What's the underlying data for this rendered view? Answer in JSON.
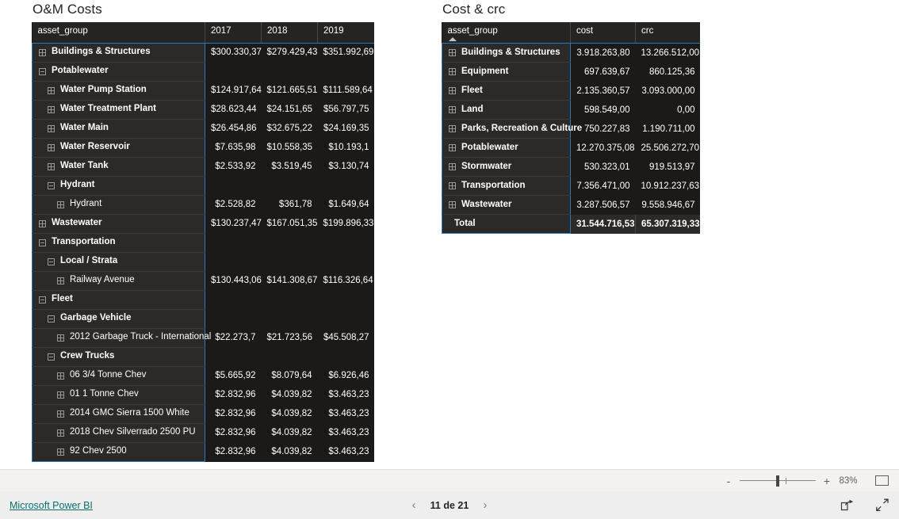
{
  "visuals": {
    "left": {
      "title": "O&M Costs",
      "columns": [
        "asset_group",
        "2017",
        "2018",
        "2019"
      ],
      "rows": [
        {
          "label": "Buildings & Structures",
          "level": 0,
          "bold": true,
          "icon": "plus",
          "values": [
            "$300.330,37",
            "$279.429,43",
            "$351.992,69"
          ]
        },
        {
          "label": "Potablewater",
          "level": 0,
          "bold": true,
          "icon": "minus",
          "values": [
            "",
            "",
            ""
          ]
        },
        {
          "label": "Water Pump Station",
          "level": 1,
          "bold": true,
          "icon": "plus",
          "values": [
            "$124.917,64",
            "$121.665,51",
            "$111.589,64"
          ]
        },
        {
          "label": "Water Treatment Plant",
          "level": 1,
          "bold": true,
          "icon": "plus",
          "values": [
            "$28.623,44",
            "$24.151,65",
            "$56.797,75"
          ]
        },
        {
          "label": "Water Main",
          "level": 1,
          "bold": true,
          "icon": "plus",
          "values": [
            "$26.454,86",
            "$32.675,22",
            "$24.169,35"
          ]
        },
        {
          "label": "Water Reservoir",
          "level": 1,
          "bold": true,
          "icon": "plus",
          "values": [
            "$7.635,98",
            "$10.558,35",
            "$10.193,1"
          ]
        },
        {
          "label": "Water Tank",
          "level": 1,
          "bold": true,
          "icon": "plus",
          "values": [
            "$2.533,92",
            "$3.519,45",
            "$3.130,74"
          ]
        },
        {
          "label": "Hydrant",
          "level": 1,
          "bold": true,
          "icon": "minus",
          "values": [
            "",
            "",
            ""
          ]
        },
        {
          "label": "Hydrant",
          "level": 2,
          "bold": false,
          "icon": "plus",
          "values": [
            "$2.528,82",
            "$361,78",
            "$1.649,64"
          ]
        },
        {
          "label": "Wastewater",
          "level": 0,
          "bold": true,
          "icon": "plus",
          "values": [
            "$130.237,47",
            "$167.051,35",
            "$199.896,33"
          ]
        },
        {
          "label": "Transportation",
          "level": 0,
          "bold": true,
          "icon": "minus",
          "values": [
            "",
            "",
            ""
          ]
        },
        {
          "label": "Local / Strata",
          "level": 1,
          "bold": true,
          "icon": "minus",
          "values": [
            "",
            "",
            ""
          ]
        },
        {
          "label": "Railway Avenue",
          "level": 2,
          "bold": false,
          "icon": "plus",
          "values": [
            "$130.443,06",
            "$141.308,67",
            "$116.326,64"
          ]
        },
        {
          "label": "Fleet",
          "level": 0,
          "bold": true,
          "icon": "minus",
          "values": [
            "",
            "",
            ""
          ]
        },
        {
          "label": "Garbage Vehicle",
          "level": 1,
          "bold": true,
          "icon": "minus",
          "values": [
            "",
            "",
            ""
          ]
        },
        {
          "label": "2012 Garbage Truck - International",
          "level": 2,
          "bold": false,
          "icon": "plus",
          "values": [
            "$22.273,7",
            "$21.723,56",
            "$45.508,27"
          ]
        },
        {
          "label": "Crew Trucks",
          "level": 1,
          "bold": true,
          "icon": "minus",
          "values": [
            "",
            "",
            ""
          ]
        },
        {
          "label": "06 3/4 Tonne Chev",
          "level": 2,
          "bold": false,
          "icon": "plus",
          "values": [
            "$5.665,92",
            "$8.079,64",
            "$6.926,46"
          ]
        },
        {
          "label": "01 1 Tonne Chev",
          "level": 2,
          "bold": false,
          "icon": "plus",
          "values": [
            "$2.832,96",
            "$4.039,82",
            "$3.463,23"
          ]
        },
        {
          "label": "2014 GMC Sierra 1500 White",
          "level": 2,
          "bold": false,
          "icon": "plus",
          "values": [
            "$2.832,96",
            "$4.039,82",
            "$3.463,23"
          ]
        },
        {
          "label": "2018 Chev Silverrado 2500 PU",
          "level": 2,
          "bold": false,
          "icon": "plus",
          "values": [
            "$2.832,96",
            "$4.039,82",
            "$3.463,23"
          ]
        },
        {
          "label": "92 Chev 2500",
          "level": 2,
          "bold": false,
          "icon": "plus",
          "values": [
            "$2.832,96",
            "$4.039,82",
            "$3.463,23"
          ]
        }
      ]
    },
    "right": {
      "title": "Cost & crc",
      "columns": [
        "asset_group",
        "cost",
        "crc"
      ],
      "sort_column": "asset_group",
      "sort_direction": "ascending",
      "rows": [
        {
          "label": "Buildings & Structures",
          "icon": "plus",
          "values": [
            "3.918.263,80",
            "13.266.512,00"
          ]
        },
        {
          "label": "Equipment",
          "icon": "plus",
          "values": [
            "697.639,67",
            "860.125,36"
          ]
        },
        {
          "label": "Fleet",
          "icon": "plus",
          "values": [
            "2.135.360,57",
            "3.093.000,00"
          ]
        },
        {
          "label": "Land",
          "icon": "plus",
          "values": [
            "598.549,00",
            "0,00"
          ]
        },
        {
          "label": "Parks, Recreation & Culture",
          "icon": "plus",
          "values": [
            "750.227,83",
            "1.190.711,00"
          ]
        },
        {
          "label": "Potablewater",
          "icon": "plus",
          "values": [
            "12.270.375,08",
            "25.506.272,70"
          ]
        },
        {
          "label": "Stormwater",
          "icon": "plus",
          "values": [
            "530.323,01",
            "919.513,97"
          ]
        },
        {
          "label": "Transportation",
          "icon": "plus",
          "values": [
            "7.356.471,00",
            "10.912.237,63"
          ]
        },
        {
          "label": "Wastewater",
          "icon": "plus",
          "values": [
            "3.287.506,57",
            "9.558.946,67"
          ]
        }
      ],
      "total": {
        "label": "Total",
        "values": [
          "31.544.716,53",
          "65.307.319,33"
        ]
      }
    }
  },
  "zoombar": {
    "minus_label": "-",
    "plus_label": "+",
    "zoom_level": "83%",
    "fit_icon": "fit-to-page-icon"
  },
  "footer": {
    "brand": "Microsoft Power BI",
    "prev_arrow": "‹",
    "next_arrow": "›",
    "page_label": "11 de 21",
    "share_icon": "share-icon",
    "fullscreen_icon": "fullscreen-icon"
  },
  "colors": {
    "matrix_bg": "#1b1a19",
    "row_header_bg": "#2b2a28",
    "cell_bg": "#201f1e",
    "header_bg": "#252423",
    "accent_border": "#2b79b8",
    "brand_link": "#0a6e6e",
    "canvas_bg": "#ffffff"
  }
}
